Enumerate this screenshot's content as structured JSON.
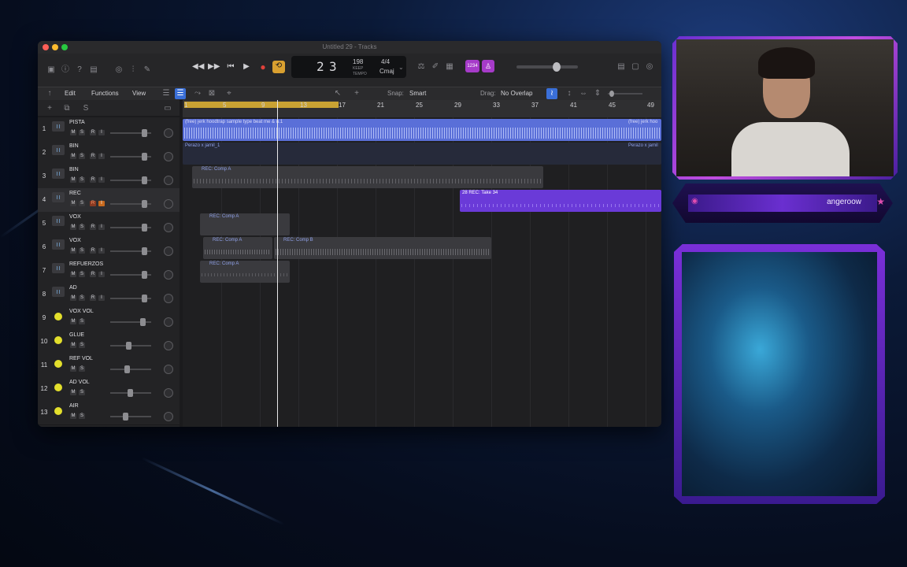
{
  "window": {
    "title": "Untitled 29 - Tracks",
    "traffic_colors": [
      "#ff5f57",
      "#febc2e",
      "#28c840"
    ]
  },
  "control_bar": {
    "lcd_bar": "2",
    "lcd_beat": "3",
    "tempo": "198",
    "tempo_label": "KEEP",
    "tempo_sub": "TEMPO",
    "signature": "4/4",
    "key": "Cmaj",
    "count_in_badge": "1234"
  },
  "edit_bar": {
    "menus": [
      "Edit",
      "Functions",
      "View"
    ],
    "snap_label": "Snap:",
    "snap_value": "Smart",
    "drag_label": "Drag:",
    "drag_value": "No Overlap"
  },
  "ruler": {
    "bars": [
      "1",
      "5",
      "9",
      "13",
      "17",
      "21",
      "25",
      "29",
      "33",
      "37",
      "41",
      "45",
      "49"
    ]
  },
  "tracks": [
    {
      "num": "1",
      "name": "PISTA",
      "type": "audio",
      "buttons": [
        "M",
        "S",
        "R",
        "I"
      ]
    },
    {
      "num": "2",
      "name": "BIN",
      "type": "audio",
      "buttons": [
        "M",
        "S",
        "R",
        "I"
      ]
    },
    {
      "num": "3",
      "name": "BIN",
      "type": "audio",
      "buttons": [
        "M",
        "S",
        "R",
        "I"
      ]
    },
    {
      "num": "4",
      "name": "REC",
      "type": "audio",
      "buttons": [
        "M",
        "S",
        "R",
        "I"
      ]
    },
    {
      "num": "5",
      "name": "VOX",
      "type": "audio",
      "buttons": [
        "M",
        "S",
        "R",
        "I"
      ]
    },
    {
      "num": "6",
      "name": "VOX",
      "type": "audio",
      "buttons": [
        "M",
        "S",
        "R",
        "I"
      ]
    },
    {
      "num": "7",
      "name": "REFUERZOS",
      "type": "audio",
      "buttons": [
        "M",
        "S",
        "R",
        "I"
      ]
    },
    {
      "num": "8",
      "name": "AD",
      "type": "audio",
      "buttons": [
        "M",
        "S",
        "R",
        "I"
      ]
    },
    {
      "num": "9",
      "name": "VOX VOL",
      "type": "aux",
      "buttons": [
        "M",
        "S"
      ]
    },
    {
      "num": "10",
      "name": "GLUE",
      "type": "aux",
      "buttons": [
        "M",
        "S"
      ]
    },
    {
      "num": "11",
      "name": "REF VOL",
      "type": "aux",
      "buttons": [
        "M",
        "S"
      ]
    },
    {
      "num": "12",
      "name": "AD VOL",
      "type": "aux",
      "buttons": [
        "M",
        "S"
      ]
    },
    {
      "num": "13",
      "name": "AIR",
      "type": "aux",
      "buttons": [
        "M",
        "S"
      ]
    }
  ],
  "regions": {
    "beat_label": "(free) jerk  hoodtrap sample type beat me & u.1",
    "beat_label_right": "(free) jerk  hoo",
    "bin_label": "Perazo x jamil_1",
    "bin_label_right": "Perazo x jamil",
    "comp_a": "REC: Comp A",
    "take_34": "28  REC: Take 34",
    "comp_b": "REC: Comp B"
  },
  "overlay": {
    "streamer_name": "angeroow"
  }
}
